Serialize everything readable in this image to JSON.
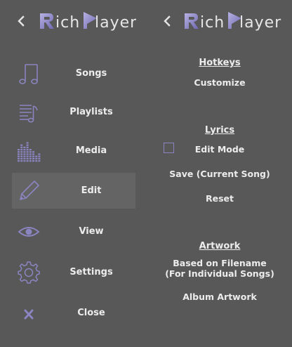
{
  "app": {
    "logo_letters": [
      "R",
      "ich ",
      "P",
      "layer"
    ]
  },
  "colors": {
    "background": "#585858",
    "active_item": "#646464",
    "icon_accent": "#8a84c0",
    "text": "#ececec"
  },
  "left_panel": {
    "back_icon": "chevron-left-icon",
    "items": [
      {
        "label": "Songs",
        "icon": "music-note-icon"
      },
      {
        "label": "Playlists",
        "icon": "playlist-icon"
      },
      {
        "label": "Media",
        "icon": "equalizer-icon"
      },
      {
        "label": "Edit",
        "icon": "pencil-icon",
        "active": true
      },
      {
        "label": "View",
        "icon": "eye-icon"
      },
      {
        "label": "Settings",
        "icon": "gear-icon"
      },
      {
        "label": "Close",
        "icon": "close-icon"
      }
    ]
  },
  "right_panel": {
    "back_icon": "chevron-left-icon",
    "hotkeys": {
      "title": "Hotkeys",
      "customize": "Customize"
    },
    "lyrics": {
      "title": "Lyrics",
      "edit_mode": "Edit Mode",
      "edit_mode_checked": false,
      "save": "Save (Current Song)",
      "reset": "Reset"
    },
    "artwork": {
      "title": "Artwork",
      "based_on_filename_line1": "Based on Filename",
      "based_on_filename_line2": "(For Individual Songs)",
      "album_artwork": "Album Artwork"
    }
  }
}
